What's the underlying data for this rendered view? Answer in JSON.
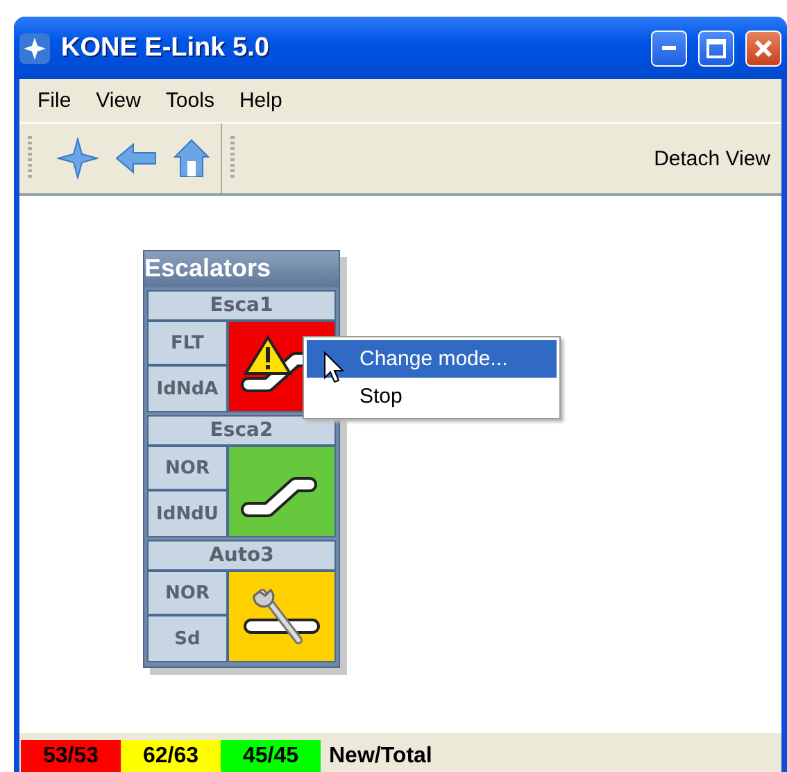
{
  "window": {
    "title": "KONE E-Link 5.0"
  },
  "menu": [
    "File",
    "View",
    "Tools",
    "Help"
  ],
  "toolbar": {
    "detach": "Detach View"
  },
  "group": {
    "title": "Escalators",
    "units": [
      {
        "name": "Esca1",
        "codes": [
          "FLT",
          "IdNdA"
        ],
        "kind": "fault"
      },
      {
        "name": "Esca2",
        "codes": [
          "NOR",
          "IdNdU"
        ],
        "kind": "normal"
      },
      {
        "name": "Auto3",
        "codes": [
          "NOR",
          "Sd"
        ],
        "kind": "maintenance"
      }
    ]
  },
  "context_menu": [
    {
      "label": "Change mode...",
      "selected": true
    },
    {
      "label": "Stop",
      "selected": false
    }
  ],
  "status_bar": {
    "counts": [
      {
        "text": "53/53",
        "color": "#ff0000"
      },
      {
        "text": "62/63",
        "color": "#ffff00"
      },
      {
        "text": "45/45",
        "color": "#00ff00"
      }
    ],
    "legend": "New/Total"
  }
}
